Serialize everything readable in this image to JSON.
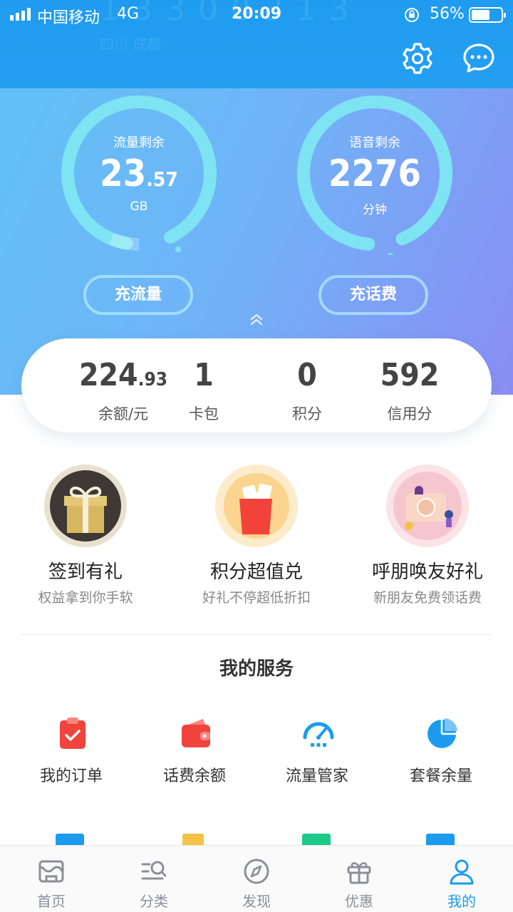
{
  "status_bar": {
    "carrier": "中国移动",
    "network": "4G",
    "time": "20:09",
    "battery": "56%"
  },
  "header": {
    "ghost_number": "1 3 3 0 0 3 1 3",
    "ghost_location": "四川 成都",
    "icons": [
      "gear-icon",
      "message-icon"
    ]
  },
  "gauges": {
    "data": {
      "label": "流量剩余",
      "value_int": "23",
      "value_dec": ".57",
      "unit": "GB"
    },
    "voice": {
      "label": "语音剩余",
      "value": "2276",
      "unit": "分钟"
    }
  },
  "buttons": {
    "recharge_data": "充流量",
    "recharge_bill": "充话费"
  },
  "stats": [
    {
      "value_int": "224",
      "value_dec": ".93",
      "caption": "余额/元"
    },
    {
      "value_int": "1",
      "value_dec": "",
      "caption": "卡包"
    },
    {
      "value_int": "0",
      "value_dec": "",
      "caption": "积分"
    },
    {
      "value_int": "592",
      "value_dec": "",
      "caption": "信用分"
    }
  ],
  "promos": [
    {
      "title": "签到有礼",
      "subtitle": "权益拿到你手软",
      "icon": "gift-icon"
    },
    {
      "title": "积分超值兑",
      "subtitle": "好礼不停超低折扣",
      "icon": "shopping-bag-icon"
    },
    {
      "title": "呼朋唤友好礼",
      "subtitle": "新朋友免费领话费",
      "icon": "invite-coupon-icon"
    }
  ],
  "services": {
    "title": "我的服务",
    "items": [
      {
        "label": "我的订单",
        "icon": "order-clipboard-icon",
        "color": "#f0443c"
      },
      {
        "label": "话费余额",
        "icon": "wallet-icon",
        "color": "#f0443c"
      },
      {
        "label": "流量管家",
        "icon": "speedometer-icon",
        "color": "#1c9bf0"
      },
      {
        "label": "套餐余量",
        "icon": "pie-chart-icon",
        "color": "#1c9bf0"
      }
    ]
  },
  "tabbar": [
    {
      "label": "首页",
      "icon": "home-icon"
    },
    {
      "label": "分类",
      "icon": "category-icon"
    },
    {
      "label": "发现",
      "icon": "compass-icon"
    },
    {
      "label": "优惠",
      "icon": "gift-icon"
    },
    {
      "label": "我的",
      "icon": "user-icon",
      "active": true
    }
  ],
  "colors": {
    "brand_blue": "#1c9bf0",
    "accent_red": "#f0443c",
    "gauge_ring": "#7ee3f2"
  }
}
